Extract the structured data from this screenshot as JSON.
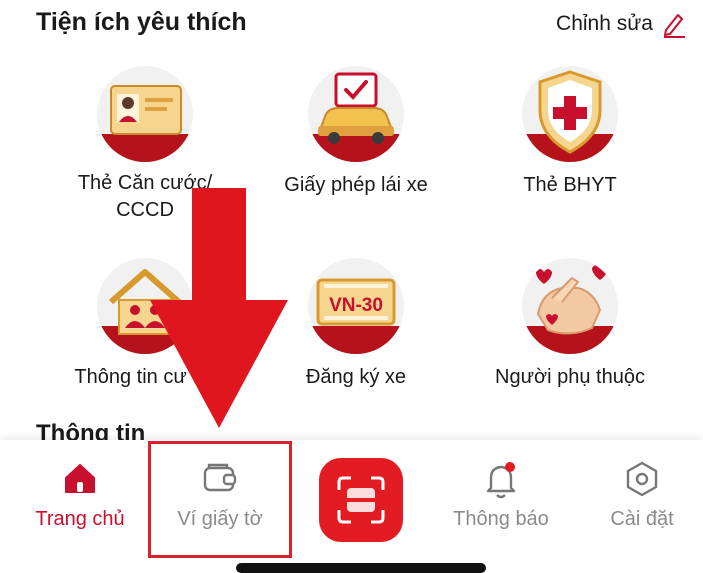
{
  "header": {
    "title": "Tiện ích yêu thích",
    "edit_label": "Chỉnh sửa"
  },
  "tiles": [
    {
      "label_line1": "Thẻ Căn cước/",
      "label_line2": "CCCD",
      "icon": "id-card-icon"
    },
    {
      "label_line1": "Giấy phép lái xe",
      "label_line2": "",
      "icon": "driver-license-icon"
    },
    {
      "label_line1": "Thẻ BHYT",
      "label_line2": "",
      "icon": "health-insurance-icon"
    },
    {
      "label_line1": "Thông tin cư trú",
      "label_line2": "",
      "icon": "residence-icon"
    },
    {
      "label_line1": "Đăng ký xe",
      "label_line2": "",
      "icon": "vehicle-registration-icon",
      "plate_text": "VN-30"
    },
    {
      "label_line1": "Người phụ thuộc",
      "label_line2": "",
      "icon": "dependents-icon"
    }
  ],
  "section2": {
    "title": "Thông tin"
  },
  "tabbar": {
    "items": [
      {
        "label": "Trang chủ",
        "icon": "home-icon",
        "active": true
      },
      {
        "label": "Ví giấy tờ",
        "icon": "wallet-icon",
        "active": false
      },
      {
        "label": "",
        "icon": "scan-icon",
        "active": false
      },
      {
        "label": "Thông báo",
        "icon": "bell-icon",
        "active": false
      },
      {
        "label": "Cài đặt",
        "icon": "settings-icon",
        "active": false
      }
    ]
  },
  "colors": {
    "accent": "#c8102e",
    "scan_button": "#e31b23",
    "arrow": "#e0161e",
    "muted_text": "#8a8a8a"
  }
}
